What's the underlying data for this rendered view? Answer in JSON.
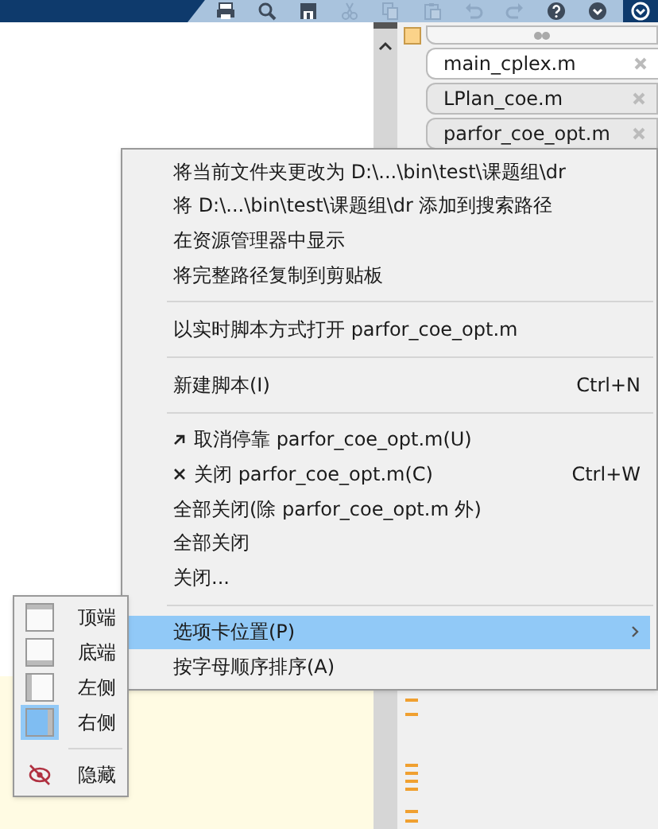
{
  "toolbar": {
    "buttons": [
      {
        "kind": "print",
        "disabled": false
      },
      {
        "kind": "search",
        "disabled": false
      },
      {
        "kind": "save",
        "disabled": false
      },
      {
        "kind": "cut",
        "disabled": true
      },
      {
        "kind": "copy",
        "disabled": true
      },
      {
        "kind": "paste",
        "disabled": true
      },
      {
        "kind": "undo",
        "disabled": true
      },
      {
        "kind": "redo",
        "disabled": true
      },
      {
        "kind": "help",
        "disabled": false
      },
      {
        "kind": "more",
        "disabled": false
      }
    ]
  },
  "tabs": [
    {
      "label": "main_cplex.m",
      "selected": true
    },
    {
      "label": "LPlan_coe.m",
      "selected": false
    },
    {
      "label": "parfor_coe_opt.m",
      "selected": false
    }
  ],
  "context_menu": {
    "items": [
      {
        "kind": "item",
        "label": "将当前文件夹更改为 D:\\...\\bin\\test\\课题组\\dr",
        "selected": false
      },
      {
        "kind": "item",
        "label": "将 D:\\...\\bin\\test\\课题组\\dr 添加到搜索路径",
        "selected": false
      },
      {
        "kind": "item",
        "label": "在资源管理器中显示",
        "selected": false
      },
      {
        "kind": "item",
        "label": "将完整路径复制到剪贴板",
        "selected": false
      },
      {
        "kind": "separator"
      },
      {
        "kind": "item",
        "label": "以实时脚本方式打开 parfor_coe_opt.m",
        "selected": false
      },
      {
        "kind": "separator"
      },
      {
        "kind": "item",
        "label": "新建脚本(I)",
        "shortcut": "Ctrl+N",
        "selected": false
      },
      {
        "kind": "separator"
      },
      {
        "kind": "undock",
        "label": "取消停靠 parfor_coe_opt.m(U)",
        "selected": false
      },
      {
        "kind": "close",
        "label": "关闭 parfor_coe_opt.m(C)",
        "shortcut": "Ctrl+W",
        "selected": false
      },
      {
        "kind": "item",
        "label": "全部关闭(除 parfor_coe_opt.m 外)",
        "selected": false
      },
      {
        "kind": "item",
        "label": "全部关闭",
        "selected": false
      },
      {
        "kind": "item",
        "label": "关闭...",
        "selected": false
      },
      {
        "kind": "separator"
      },
      {
        "kind": "item",
        "label": "选项卡位置(P)",
        "submenu": true,
        "selected": true
      },
      {
        "kind": "item",
        "label": "按字母顺序排序(A)",
        "selected": false
      }
    ]
  },
  "submenu": {
    "items": [
      {
        "kind": "top",
        "label": "顶端",
        "selected": false
      },
      {
        "kind": "bottom",
        "label": "底端",
        "selected": false
      },
      {
        "kind": "left",
        "label": "左侧",
        "selected": false
      },
      {
        "kind": "right",
        "label": "右侧",
        "selected": true
      },
      {
        "kind": "separator"
      },
      {
        "kind": "hide",
        "label": "隐藏",
        "selected": false
      }
    ]
  }
}
